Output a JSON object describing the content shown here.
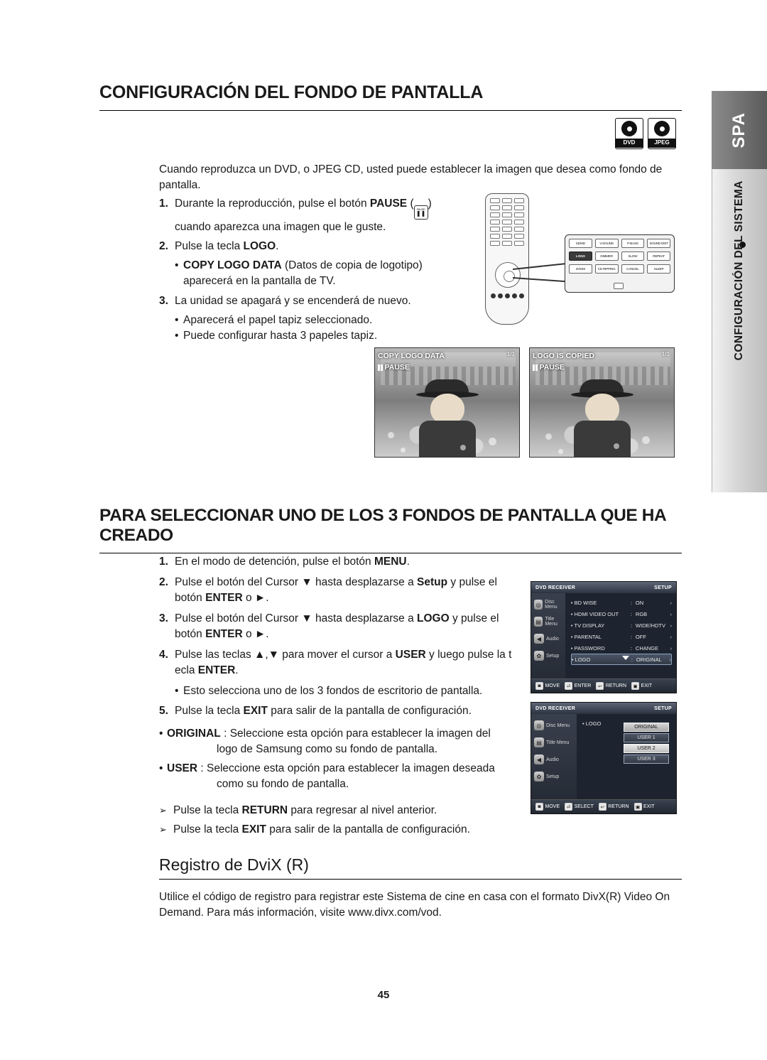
{
  "page": {
    "number": "45",
    "side_tab_lang": "SPA",
    "side_tab_section": "CONFIGURACIÓN DEL SISTEMA"
  },
  "disc_icons": [
    {
      "name": "dvd-disc-icon",
      "label": "DVD"
    },
    {
      "name": "jpeg-disc-icon",
      "label": "JPEG"
    }
  ],
  "section1": {
    "title": "CONFIGURACIÓN DEL FONDO DE PANTALLA",
    "intro": "Cuando reproduzca un DVD, o JPEG CD, usted puede establecer la imagen que desea como fondo de pantalla.",
    "steps": [
      {
        "num": "1.",
        "text_pre": "Durante la reproducción, pulse el botón ",
        "bold": "PAUSE",
        "text_post": "",
        "text_line2": "cuando aparezca una imagen que le guste.",
        "icon": "pause-button-icon"
      },
      {
        "num": "2.",
        "text_pre": "Pulse la tecla ",
        "bold": "LOGO",
        "text_post": ".",
        "sub": [
          {
            "bold": "COPY LOGO DATA",
            "text": " (Datos de copia de logotipo)",
            "line2": "aparecerá en la pantalla de TV."
          }
        ]
      },
      {
        "num": "3.",
        "text_pre": "La unidad se apagará y se encenderá de nuevo.",
        "bold": "",
        "text_post": "",
        "sub": [
          {
            "bold": "",
            "text": "Aparecerá el papel tapiz seleccionado."
          },
          {
            "bold": "",
            "text": "Puede configurar hasta 3 papeles tapiz."
          }
        ]
      }
    ],
    "remote_callout": {
      "rows": [
        [
          "SD/HD",
          "V-SOUND",
          "P-BASS",
          "SOUND EDIT"
        ],
        [
          "LOGO",
          "DIMMER",
          "SLOW",
          "REPEAT"
        ],
        [
          "ZOOM",
          "CD RIPPING",
          "CANCEL",
          "SLEEP"
        ]
      ],
      "highlight": "LOGO"
    },
    "photos": [
      {
        "name": "photo-copy-logo-data",
        "line1": "COPY LOGO DATA",
        "line2": "PAUSE",
        "corner": "1/1"
      },
      {
        "name": "photo-logo-is-copied",
        "line1": "LOGO IS COPIED",
        "line2": "PAUSE",
        "corner": "1/1"
      }
    ]
  },
  "section2": {
    "title": "PARA SELECCIONAR UNO DE LOS 3 FONDOS DE PANTALLA QUE HA CREADO",
    "steps": [
      {
        "num": "1.",
        "parts": [
          {
            "t": "En el modo de detención, pulse el botón ",
            "b": false
          },
          {
            "t": "MENU",
            "b": true
          },
          {
            "t": ".",
            "b": false
          }
        ]
      },
      {
        "num": "2.",
        "parts": [
          {
            "t": "Pulse el botón del Cursor ▼ hasta desplazarse a ",
            "b": false
          },
          {
            "t": "Setup",
            "b": true
          },
          {
            "t": " y pulse el",
            "b": false
          }
        ],
        "line2_parts": [
          {
            "t": "botón ",
            "b": false
          },
          {
            "t": "ENTER",
            "b": true
          },
          {
            "t": " o ►.",
            "b": false
          }
        ]
      },
      {
        "num": "3.",
        "parts": [
          {
            "t": "Pulse el botón del Cursor ▼ hasta desplazarse a ",
            "b": false
          },
          {
            "t": "LOGO",
            "b": true
          },
          {
            "t": " y pulse el",
            "b": false
          }
        ],
        "line2_parts": [
          {
            "t": "botón ",
            "b": false
          },
          {
            "t": "ENTER",
            "b": true
          },
          {
            "t": " o ►.",
            "b": false
          }
        ]
      },
      {
        "num": "4.",
        "parts": [
          {
            "t": "Pulse las teclas ▲,▼ para mover el cursor a ",
            "b": false
          },
          {
            "t": "USER",
            "b": true
          },
          {
            "t": " y luego pulse la t",
            "b": false
          }
        ],
        "line2_parts": [
          {
            "t": "ecla ",
            "b": false
          },
          {
            "t": "ENTER",
            "b": true
          },
          {
            "t": ".",
            "b": false
          }
        ],
        "sub": [
          {
            "t": "Esto selecciona uno de los 3 fondos de escritorio de pantalla."
          }
        ]
      },
      {
        "num": "5.",
        "parts": [
          {
            "t": "Pulse la tecla ",
            "b": false
          },
          {
            "t": "EXIT",
            "b": true
          },
          {
            "t": " para salir de la pantalla de configuración.",
            "b": false
          }
        ]
      }
    ],
    "options": [
      {
        "bold": "ORIGINAL",
        "text": " : Seleccione esta opción para establecer la imagen del",
        "line2": "logo de Samsung como su fondo de pantalla."
      },
      {
        "bold": "USER",
        "text": " : Seleccione esta opción para establecer la imagen deseada",
        "line2": "como su fondo de pantalla."
      }
    ],
    "notes": [
      {
        "pre": "Pulse la tecla ",
        "bold": "RETURN",
        "post": " para regresar al nivel anterior."
      },
      {
        "pre": "Pulse la tecla ",
        "bold": "EXIT",
        "post": " para salir de la pantalla de configuración."
      }
    ],
    "osd1": {
      "name": "osd-setup-menu",
      "header_left": "DVD RECEIVER",
      "header_right": "SETUP",
      "left_items": [
        {
          "label": "Disc Menu",
          "icon": "disc-menu-icon"
        },
        {
          "label": "Title Menu",
          "icon": "title-menu-icon"
        },
        {
          "label": "Audio",
          "icon": "audio-icon"
        },
        {
          "label": "Setup",
          "icon": "setup-gear-icon"
        }
      ],
      "rows": [
        {
          "name": "BD WISE",
          "value": "ON",
          "selected": false
        },
        {
          "name": "HDMI VIDEO OUT",
          "value": "RGB",
          "selected": false
        },
        {
          "name": "TV DISPLAY",
          "value": "WIDE/HDTV",
          "selected": false
        },
        {
          "name": "PARENTAL",
          "value": "OFF",
          "selected": false
        },
        {
          "name": "PASSWORD",
          "value": "CHANGE",
          "selected": false
        },
        {
          "name": "LOGO",
          "value": "ORIGINAL",
          "selected": true
        }
      ],
      "bottom": [
        {
          "key": "◙",
          "label": "MOVE"
        },
        {
          "key": "⏎",
          "label": "ENTER"
        },
        {
          "key": "↩",
          "label": "RETURN"
        },
        {
          "key": "▣",
          "label": "EXIT"
        }
      ]
    },
    "osd2": {
      "name": "osd-logo-select",
      "header_left": "DVD RECEIVER",
      "header_right": "SETUP",
      "left_items": [
        {
          "label": "Disc Menu",
          "icon": "disc-menu-icon"
        },
        {
          "label": "Title Menu",
          "icon": "title-menu-icon"
        },
        {
          "label": "Audio",
          "icon": "audio-icon"
        },
        {
          "label": "Setup",
          "icon": "setup-gear-icon"
        }
      ],
      "row_label": "LOGO",
      "list": [
        {
          "label": "ORIGINAL",
          "state": "first"
        },
        {
          "label": "USER 1",
          "state": "plain"
        },
        {
          "label": "USER 2",
          "state": "highlight"
        },
        {
          "label": "USER 3",
          "state": "plain"
        }
      ],
      "bottom": [
        {
          "key": "◙",
          "label": "MOVE"
        },
        {
          "key": "⏎",
          "label": "SELECT"
        },
        {
          "key": "↩",
          "label": "RETURN"
        },
        {
          "key": "▣",
          "label": "EXIT"
        }
      ]
    }
  },
  "section3": {
    "title": "Registro de DviX (R)",
    "text": "Utilice el código de registro para registrar este Sistema de cine en casa con el formato DivX(R) Video On Demand. Para más información, visite www.divx.com/vod."
  }
}
